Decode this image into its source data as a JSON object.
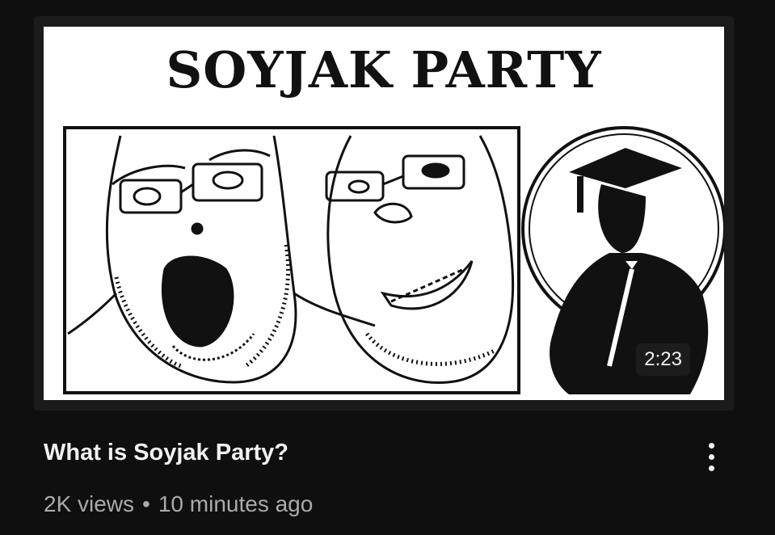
{
  "video": {
    "thumbnail_title": "SOYJAK PARTY",
    "duration": "2:23",
    "title": "What is Soyjak Party?",
    "views": "2K views",
    "separator": "•",
    "uploaded": "10 minutes ago"
  },
  "icons": {
    "more": "vertical-ellipsis-icon"
  },
  "colors": {
    "background": "#0f0f0f",
    "title_text": "#f1f1f1",
    "meta_text": "#aaaaaa",
    "badge_bg": "#1e1e1e"
  }
}
